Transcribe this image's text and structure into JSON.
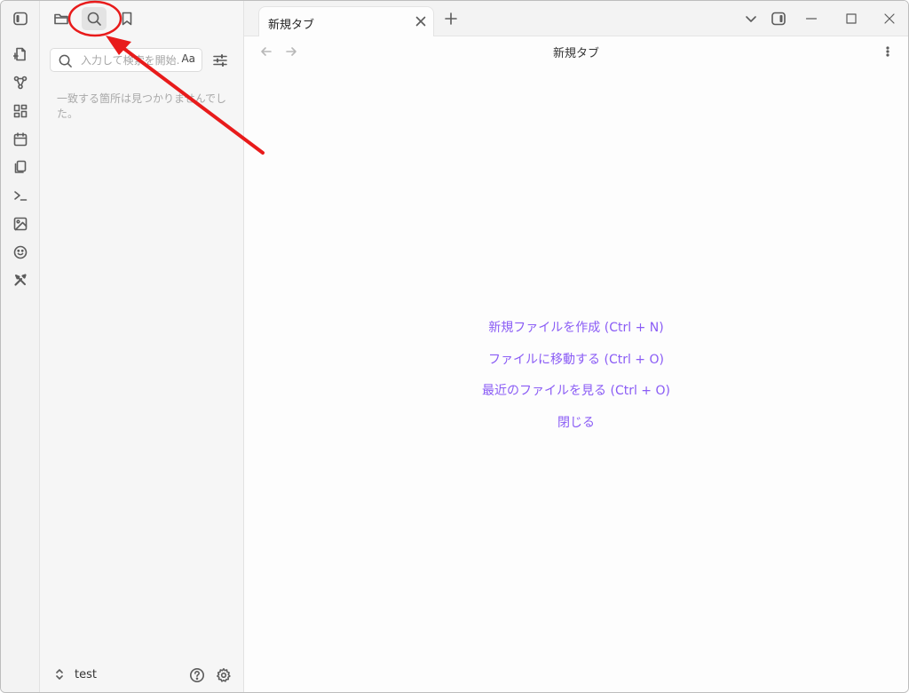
{
  "ribbon": {
    "items": [
      {
        "icon": "new-note-icon"
      },
      {
        "icon": "graph-icon"
      },
      {
        "icon": "canvas-icon"
      },
      {
        "icon": "calendar-icon"
      },
      {
        "icon": "templates-icon"
      },
      {
        "icon": "terminal-icon"
      },
      {
        "icon": "image-icon"
      },
      {
        "icon": "emoji-icon"
      },
      {
        "icon": "tools-icon"
      }
    ]
  },
  "sidebar": {
    "tabs": [
      {
        "icon": "folder-icon",
        "active": false
      },
      {
        "icon": "search-icon",
        "active": true
      },
      {
        "icon": "bookmark-icon",
        "active": false
      }
    ],
    "search": {
      "placeholder": "入力して検索を開始...",
      "case_label": "Aa"
    },
    "empty_message": "一致する箇所は見つかりませんでした。",
    "vault": {
      "name": "test"
    }
  },
  "tabs": [
    {
      "title": "新規タブ",
      "active": true
    }
  ],
  "main": {
    "title": "新規タブ",
    "actions": [
      "新規ファイルを作成 (Ctrl + N)",
      "ファイルに移動する (Ctrl + O)",
      "最近のファイルを見る (Ctrl + O)",
      "閉じる"
    ]
  },
  "colors": {
    "accent": "#8a5cf5",
    "annotation": "#e81b1b"
  }
}
